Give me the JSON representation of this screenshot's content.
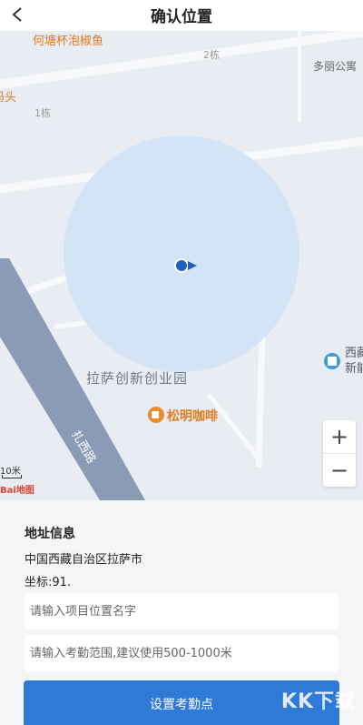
{
  "header": {
    "title": "确认位置",
    "back_icon": "chevron-left-icon"
  },
  "map": {
    "labels": {
      "poi_restaurant": "何塘杯泡椒鱼",
      "poi_left": "码头",
      "building_2": "2栋",
      "building_1": "1栋",
      "apartment": "多丽公寓",
      "park": "拉萨创新创业园",
      "cafe": "松明咖啡",
      "road": "扎西路",
      "side_1": "西藏",
      "side_2": "新能"
    },
    "zoom_in": "+",
    "zoom_out": "−",
    "scale": "10米",
    "baidu": "Bai地图"
  },
  "panel": {
    "section_title": "地址信息",
    "address": "中国西藏自治区拉萨市",
    "coord": "坐标:91.",
    "project_name_placeholder": "请输入项目位置名字",
    "range_placeholder": "请输入考勤范围,建议使用500-1000米",
    "submit_label": "设置考勤点",
    "watermark": "KK下载"
  },
  "colors": {
    "accent": "#2f7ad6",
    "range_circle": "#cfe2f7",
    "marker": "#1f5fbf"
  }
}
